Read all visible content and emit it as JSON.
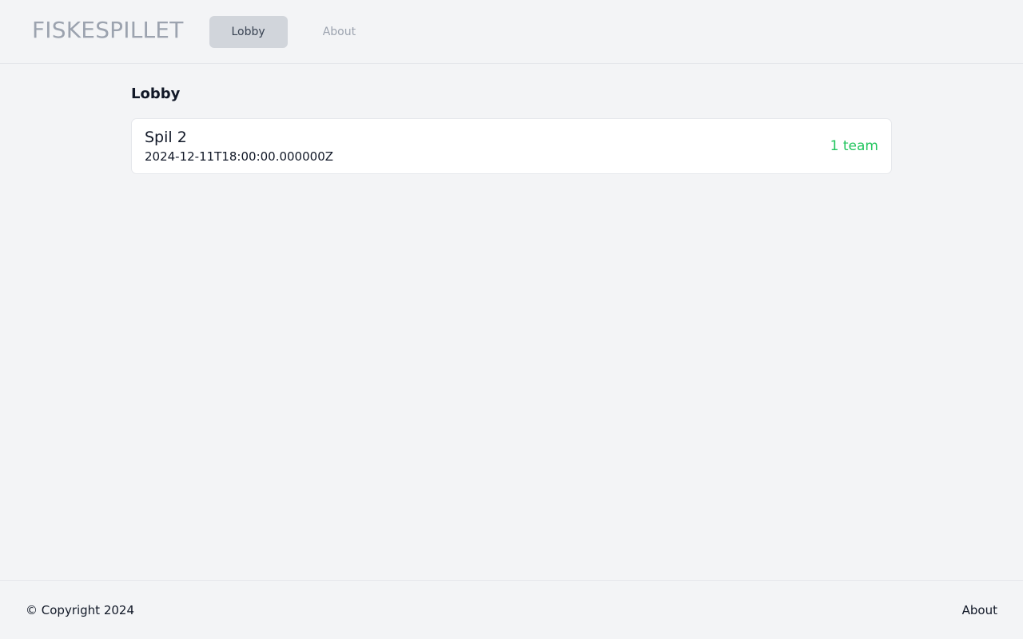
{
  "header": {
    "brand": "FISKESPILLET",
    "nav": [
      {
        "label": "Lobby",
        "active": true
      },
      {
        "label": "About",
        "active": false
      }
    ]
  },
  "main": {
    "title": "Lobby",
    "games": [
      {
        "name": "Spil 2",
        "date": "2024-12-11T18:00:00.000000Z",
        "teams": "1 team"
      }
    ]
  },
  "footer": {
    "copyright": "© Copyright 2024",
    "about_link": "About"
  },
  "colors": {
    "background": "#f3f4f6",
    "active_nav_bg": "#d1d5db",
    "team_count": "#22c55e",
    "muted_text": "#9ca3af"
  }
}
